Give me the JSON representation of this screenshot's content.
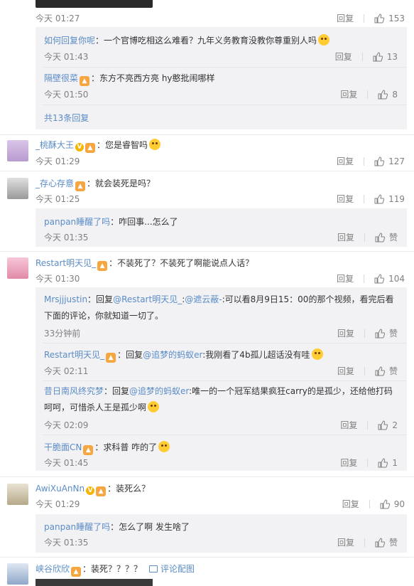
{
  "labels": {
    "reply": "回复",
    "like": "赞",
    "more_replies": "共13条回复",
    "comment_pic": "评论配图"
  },
  "c0": {
    "time": "今天 01:27",
    "likes": "153"
  },
  "r0a": {
    "user": "如何回复你呢",
    "text": "：一个官博吃相这么难看？九年义务教育没教你尊重别人吗",
    "time": "今天 01:43",
    "likes": "13"
  },
  "r0b": {
    "user": "隔壁很菜",
    "text": "：东方不亮西方亮 hy憨批闹哪样",
    "time": "今天 01:50",
    "likes": "8"
  },
  "c1": {
    "user": "_桃酥大王",
    "text": "：您是睿智吗",
    "time": "今天 01:29",
    "likes": "127"
  },
  "c2": {
    "user": "_存心存意",
    "text": "：就会装死是吗？",
    "time": "今天 01:25",
    "likes": "119"
  },
  "r2a": {
    "user": "panpan睡醒了吗",
    "text": "：咋回事...怎么了",
    "time": "今天 01:35"
  },
  "c3": {
    "user": "Restart明天见_",
    "text": "：不装死了？不装死了啊能说点人话？",
    "time": "今天 01:30",
    "likes": "104"
  },
  "r3a": {
    "user": "Mrsjjjustin",
    "text1": "：回复",
    "at": "@Restart明天见_",
    "text2": ":",
    "at2": "@遮云蔽-",
    "text3": ":可以看8月9日15：00的那个视频，看完后看下面的评论，你就知道一切了。",
    "time": "33分钟前"
  },
  "r3b": {
    "user": "Restart明天见_",
    "text1": "：回复",
    "at": "@追梦的蚂蚁er",
    "text2": ":我刚看了4b孤儿超话没有哇",
    "time": "今天 02:11"
  },
  "r3c": {
    "user": "昔日南风终究梦",
    "text1": "：回复",
    "at": "@追梦的蚂蚁er",
    "text2": ":唯一的一个冠军结果疯狂carry的是孤少，还给他打码呵呵，可惜杀人王是孤少啊",
    "time": "今天 02:09",
    "likes": "2"
  },
  "r3d": {
    "user": "干脆面CN",
    "text": "：求科普  咋的了",
    "time": "今天 01:45",
    "likes": "1"
  },
  "c4": {
    "user": "AwiXuAnNn",
    "text": "：装死么？",
    "time": "今天 01:29",
    "likes": "90"
  },
  "r4a": {
    "user": "panpan睡醒了吗",
    "text": "：怎么了啊 发生啥了",
    "time": "今天 01:35"
  },
  "c5": {
    "user": "峡谷欣欣",
    "text": "：装死？？？？"
  },
  "colors": {
    "link": "#5a8cc6",
    "reply_bg": "#f2f2f5",
    "muted": "#808080"
  }
}
